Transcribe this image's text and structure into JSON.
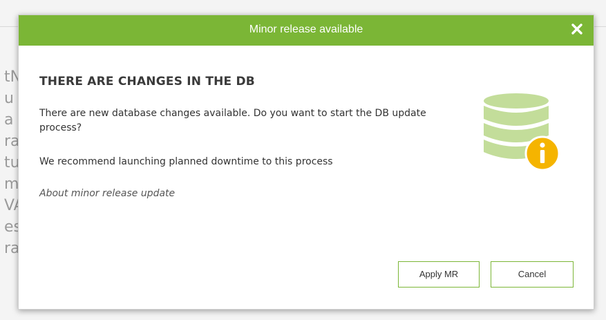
{
  "background": {
    "text_fragments": [
      "tN",
      "u",
      "a",
      "ra",
      "tu",
      "m",
      "VA",
      "es",
      "ra"
    ]
  },
  "dialog": {
    "title": "Minor release available",
    "close_icon": "close-icon",
    "heading": "THERE ARE CHANGES IN THE DB",
    "paragraph_1": "There are new database changes available. Do you want to start the DB update process?",
    "paragraph_2": "We recommend launching planned downtime to this process",
    "about_link": "About minor release update",
    "icon": "database-info-icon",
    "buttons": {
      "apply_label": "Apply MR",
      "cancel_label": "Cancel"
    }
  },
  "colors": {
    "header": "#7bb636",
    "db_icon": "#c3dd9a",
    "info_badge": "#f5b400",
    "button_border": "#7bb636"
  }
}
